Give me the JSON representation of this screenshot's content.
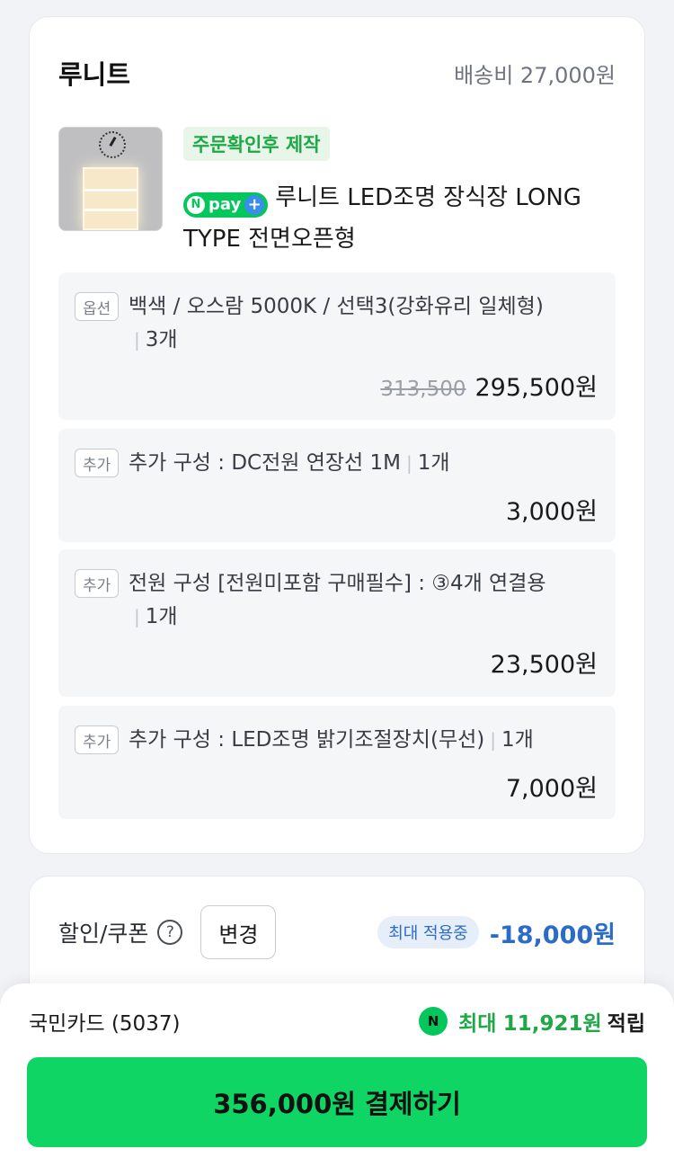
{
  "store": {
    "name": "루니트",
    "shipping": "배송비 27,000원"
  },
  "product": {
    "badge": "주문확인후 제작",
    "npay_text": "pay",
    "title": "루니트 LED조명 장식장 LONG TYPE 전면오픈형"
  },
  "options": [
    {
      "tag": "옵션",
      "text": "백색 / 오스람 5000K / 선택3(강화유리 일체형)",
      "qty": "3개",
      "original_price": "313,500",
      "price": "295,500원"
    },
    {
      "tag": "추가",
      "text": "추가 구성 : DC전원 연장선 1M",
      "qty": "1개",
      "price": "3,000원"
    },
    {
      "tag": "추가",
      "text": "전원 구성 [전원미포함 구매필수] : ③4개 연결용",
      "qty": "1개",
      "price": "23,500원"
    },
    {
      "tag": "추가",
      "text": "추가 구성 : LED조명 밝기조절장치(무선)",
      "qty": "1개",
      "price": "7,000원"
    }
  ],
  "coupon": {
    "label": "할인/쿠폰",
    "help": "?",
    "change_label": "변경",
    "badge": "최대 적용중",
    "discount": "-18,000원"
  },
  "payment": {
    "card": "국민카드 (5037)",
    "reward_prefix": "최대",
    "reward_amount": "11,921원",
    "reward_suffix": "적립",
    "pay_button": "356,000원 결제하기"
  },
  "colors": {
    "accent_green": "#0fd564",
    "npay_green": "#03c75a",
    "discount_blue": "#2b6cc8"
  },
  "icons": [
    "help-icon",
    "npay-icon",
    "npay-plus-icon",
    "naver-points-icon"
  ]
}
